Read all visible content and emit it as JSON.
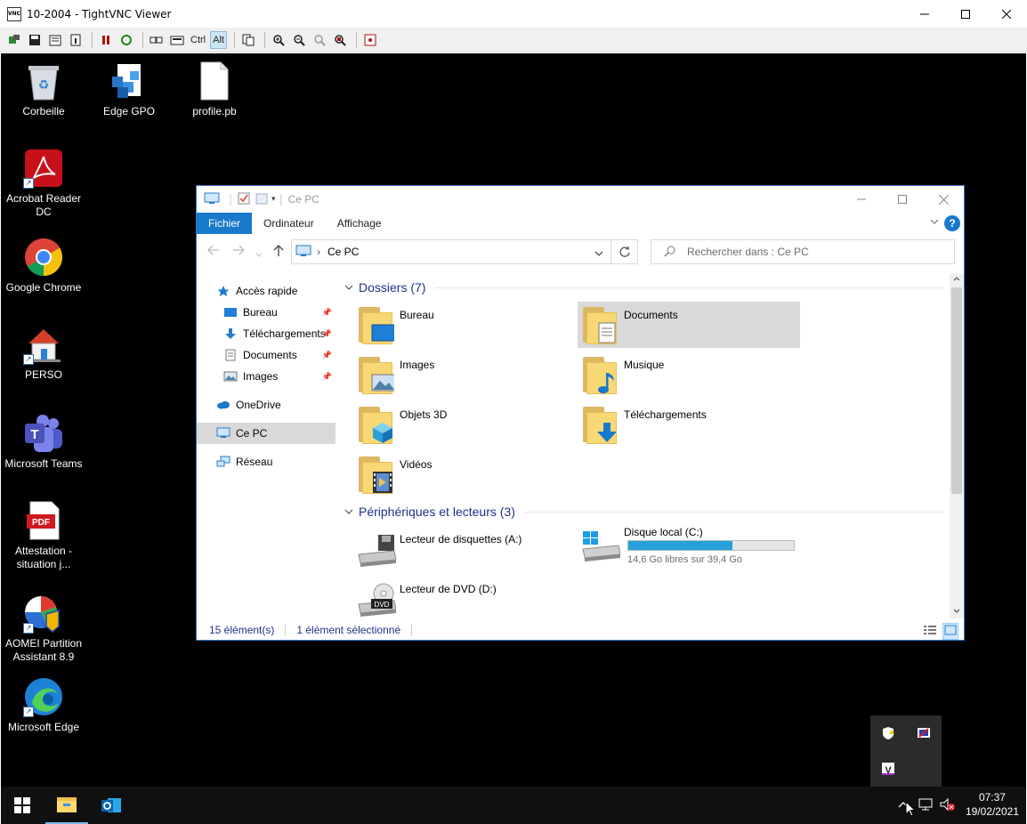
{
  "vnc": {
    "title": "10-2004 - TightVNC Viewer",
    "app_icon_text": "VNC",
    "toolbar": {
      "ctrl_label": "Ctrl",
      "alt_label": "Alt"
    }
  },
  "desktop": {
    "icons": [
      {
        "label": "Corbeille"
      },
      {
        "label": "Edge GPO"
      },
      {
        "label": "profile.pb"
      },
      {
        "label": "Acrobat Reader DC"
      },
      {
        "label": "Google Chrome"
      },
      {
        "label": "PERSO"
      },
      {
        "label": "Microsoft Teams"
      },
      {
        "label": "Attestation - situation j..."
      },
      {
        "label": "AOMEI Partition Assistant 8.9"
      },
      {
        "label": "Microsoft Edge"
      }
    ],
    "pdf_badge": "PDF",
    "teams_letter": "T"
  },
  "explorer": {
    "title": "Ce PC",
    "ribbon": {
      "tabs": [
        "Fichier",
        "Ordinateur",
        "Affichage"
      ],
      "help": "?"
    },
    "address": {
      "sep": "›",
      "path": "Ce PC"
    },
    "search": {
      "placeholder": "Rechercher dans : Ce PC"
    },
    "nav": {
      "quick_access": "Accès rapide",
      "pinned": [
        "Bureau",
        "Téléchargements",
        "Documents",
        "Images"
      ],
      "onedrive": "OneDrive",
      "this_pc": "Ce PC",
      "network": "Réseau"
    },
    "groups": {
      "folders_title": "Dossiers (7)",
      "devices_title": "Périphériques et lecteurs (3)"
    },
    "folders": [
      "Bureau",
      "Documents",
      "Images",
      "Musique",
      "Objets 3D",
      "Téléchargements",
      "Vidéos"
    ],
    "drives": {
      "floppy": "Lecteur de disquettes (A:)",
      "local_name": "Disque local (C:)",
      "local_free": "14,6 Go libres sur 39,4 Go",
      "local_used_fraction": 0.63,
      "dvd": "Lecteur de DVD (D:)",
      "dvd_badge": "DVD"
    },
    "status": {
      "count": "15 élément(s)",
      "selected": "1 élément sélectionné"
    }
  },
  "taskbar": {
    "time": "07:37",
    "date": "19/02/2021"
  },
  "colors": {
    "accent": "#1979ca",
    "folder": "#f8d775",
    "drive_bar": "#26a0da"
  }
}
